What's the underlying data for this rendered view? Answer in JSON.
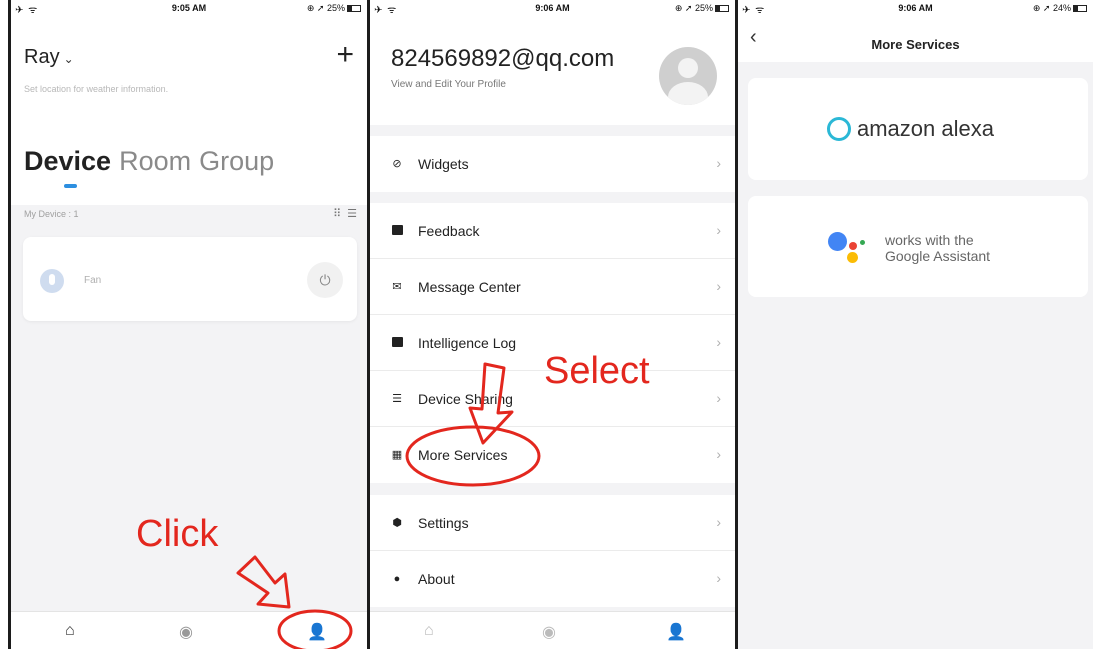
{
  "screen1": {
    "status": {
      "left": "✈ ᯤ",
      "time": "9:05 AM",
      "right": "⊕ ➚ 25%"
    },
    "home_name": "Ray",
    "home_sub": "Set location for weather information.",
    "tabs": [
      "Device",
      "Room",
      "Group"
    ],
    "my_device": "My Device : 1",
    "device_name": "Fan",
    "annotation": "Click"
  },
  "screen2": {
    "status": {
      "left": "✈ ᯤ",
      "time": "9:06 AM",
      "right": "⊕ ➚ 25%"
    },
    "email": "824569892@qq.com",
    "profile_sub": "View and Edit Your Profile",
    "groups": [
      [
        {
          "label": "Widgets",
          "icon": "widgets-icon"
        }
      ],
      [
        {
          "label": "Feedback",
          "icon": "feedback-icon"
        },
        {
          "label": "Message Center",
          "icon": "mail-icon"
        },
        {
          "label": "Intelligence Log",
          "icon": "log-icon"
        },
        {
          "label": "Device Sharing",
          "icon": "share-icon"
        },
        {
          "label": "More Services",
          "icon": "grid-icon"
        }
      ],
      [
        {
          "label": "Settings",
          "icon": "gear-icon"
        },
        {
          "label": "About",
          "icon": "info-icon"
        }
      ]
    ],
    "annotation": "Select"
  },
  "screen3": {
    "status": {
      "left": "✈ ᯤ",
      "time": "9:06 AM",
      "right": "⊕ ➚ 24%"
    },
    "title": "More Services",
    "alexa_text": "amazon alexa",
    "google_line1": "works with the",
    "google_line2": "Google Assistant"
  },
  "colors": {
    "accent_blue": "#2d8fe0",
    "annotation_red": "#e3271e",
    "alexa_cyan": "#2bb8d6"
  }
}
